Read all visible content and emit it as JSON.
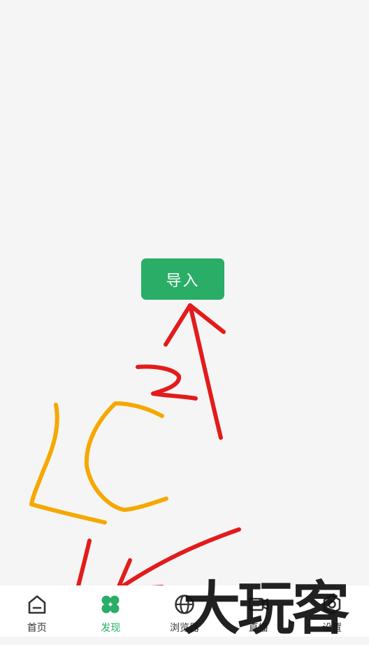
{
  "main": {
    "import_button_label": "导入"
  },
  "tabbar": {
    "items": [
      {
        "label": "首页",
        "icon": "home-icon",
        "active": false
      },
      {
        "label": "发现",
        "icon": "discover-icon",
        "active": true
      },
      {
        "label": "浏览器",
        "icon": "globe-icon",
        "active": false
      },
      {
        "label": "直播",
        "icon": "video-camera-icon",
        "active": false
      },
      {
        "label": "设置",
        "icon": "settings-icon",
        "active": false
      }
    ]
  },
  "annotations": {
    "labels": [
      "1",
      "2",
      "LC"
    ]
  },
  "watermark": {
    "text": "大玩客"
  },
  "colors": {
    "accent": "#2aad67",
    "background": "#f5f5f5",
    "annotation_red": "#e31b1b",
    "annotation_orange": "#f5a800"
  }
}
